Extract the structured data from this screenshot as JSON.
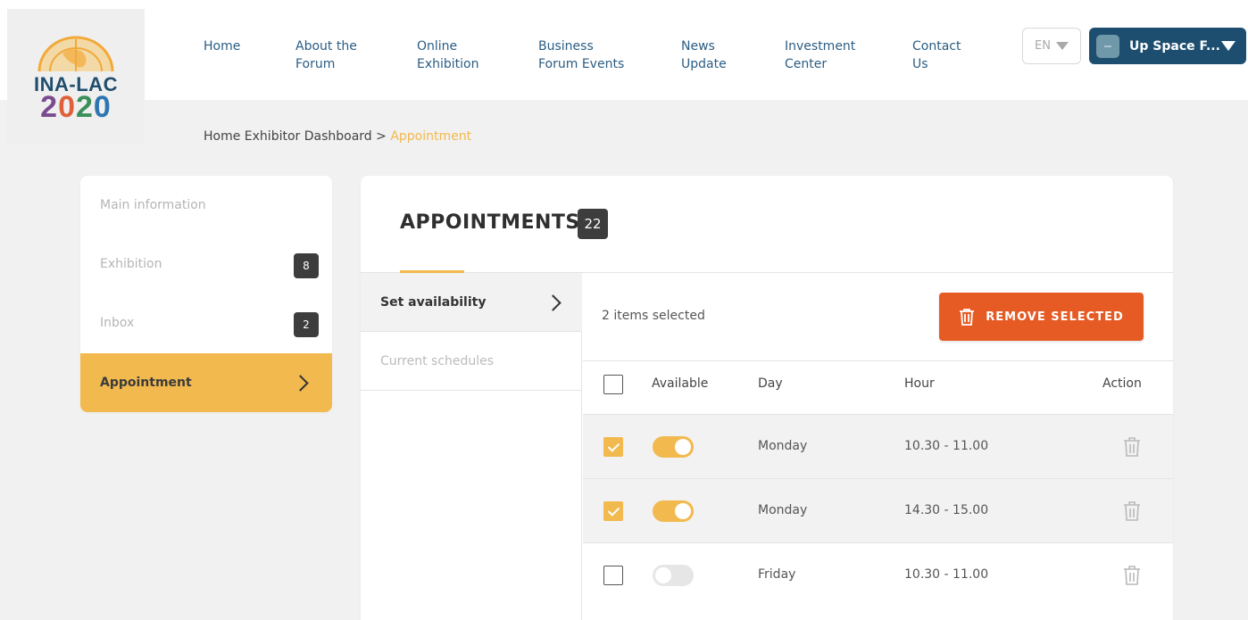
{
  "brand": {
    "logo_text": "INA-LAC",
    "logo_year_digits": [
      "2",
      "0",
      "2",
      "0"
    ]
  },
  "nav": [
    {
      "line1": "Home",
      "line2": ""
    },
    {
      "line1": "About the",
      "line2": "Forum"
    },
    {
      "line1": "Online",
      "line2": "Exhibition"
    },
    {
      "line1": "Business",
      "line2": "Forum Events"
    },
    {
      "line1": "News",
      "line2": "Update"
    },
    {
      "line1": "Investment",
      "line2": "Center"
    },
    {
      "line1": "Contact",
      "line2": "Us"
    }
  ],
  "language": {
    "selected": "EN"
  },
  "user": {
    "name": "Up Space F..."
  },
  "breadcrumb": {
    "trail": "Home Exhibitor Dashboard > ",
    "current": "Appointment"
  },
  "sidebar": {
    "items": [
      {
        "label": "Main information",
        "badge": ""
      },
      {
        "label": "Exhibition",
        "badge": "8"
      },
      {
        "label": "Inbox",
        "badge": "2"
      },
      {
        "label": "Appointment",
        "badge": ""
      }
    ],
    "active_index": 3
  },
  "panel": {
    "title": "APPOINTMENTS",
    "count": "22",
    "subnav": [
      {
        "label": "Set availability"
      },
      {
        "label": "Current schedules"
      }
    ],
    "selected_info": "2 items selected",
    "remove_label": "REMOVE SELECTED",
    "columns": {
      "available": "Available",
      "day": "Day",
      "hour": "Hour",
      "action": "Action"
    },
    "rows": [
      {
        "selected": true,
        "available": true,
        "day": "Monday",
        "hour": "10.30 - 11.00"
      },
      {
        "selected": true,
        "available": true,
        "day": "Monday",
        "hour": "14.30 - 15.00"
      },
      {
        "selected": false,
        "available": false,
        "day": "Friday",
        "hour": "10.30 - 11.00"
      }
    ]
  },
  "colors": {
    "accent": "#f2b94e",
    "primary": "#1d4e70",
    "danger": "#e65a24",
    "badge": "#3d3d3d"
  }
}
